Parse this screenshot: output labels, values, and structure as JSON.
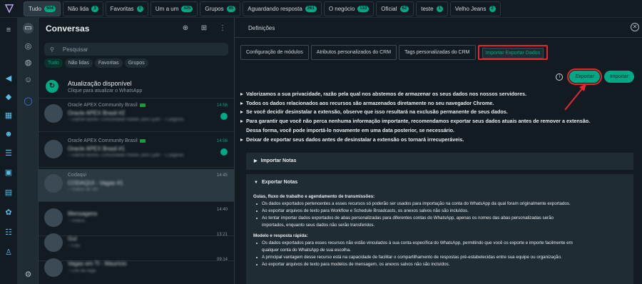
{
  "filter_tabs": [
    {
      "label": "Tudo",
      "count": "504",
      "active": true
    },
    {
      "label": "Não lida",
      "count": "3"
    },
    {
      "label": "Favoritas",
      "count": "0"
    },
    {
      "label": "Um a um",
      "count": "425"
    },
    {
      "label": "Grupos",
      "count": "85"
    },
    {
      "label": "Aguardando resposta",
      "count": "261"
    },
    {
      "label": "O negócio",
      "count": "133"
    },
    {
      "label": "Oficial",
      "count": "62"
    },
    {
      "label": "teste",
      "count": "1"
    },
    {
      "label": "Velho Jeans",
      "count": "2"
    }
  ],
  "chats": {
    "title": "Conversas",
    "search_placeholder": "Pesquisar",
    "pills": [
      "Tudo",
      "Não lidas",
      "Favoritas",
      "Grupos"
    ],
    "update": {
      "title": "Atualização disponível",
      "subtitle": "Clique para atualizar o WhatsApp"
    },
    "rows": [
      {
        "label": "Oracle APEX Community Brasil",
        "name": "Oracle APEX Brasil #2",
        "msg": "~ Gabriel Benko: Comunidade Rafael, pelo Lyall! ~ 2 páginas",
        "time": "14:56",
        "unread": true,
        "flag": true
      },
      {
        "label": "Oracle APEX Community Brasil",
        "name": "Oracle APEX Brasil #1",
        "msg": "~ Gabriel Benko: Comunidade Rafael, pelo Lyall! ~ 2 páginas",
        "time": "14:56",
        "unread": true,
        "flag": true
      },
      {
        "label": "Codaqui",
        "name": "CODAQUI - Vagas #1",
        "msg": "~ Vídeos 4k Ver",
        "time": "14:45",
        "selected": true
      },
      {
        "label": "",
        "name": "Mensagens",
        "msg": "~ Vídeos",
        "time": "14:40"
      },
      {
        "label": "",
        "name": "Guí",
        "msg": "~ Foto",
        "time": "13:21"
      },
      {
        "label": "",
        "name": "Vagas em TI - Maurício",
        "msg": "~ Link da vaga",
        "time": "09:14"
      }
    ]
  },
  "settings": {
    "title": "Definições",
    "tabs": [
      "Configuração de módulos",
      "Atributos personalizados do CRM",
      "Tags personalizadas do CRM",
      "Importar Exportar Dados"
    ],
    "export_label": "Exportar",
    "import_label": "Importar",
    "bullets": [
      "Valorizamos a sua privacidade, razão pela qual nos abstemos de armazenar os seus dados nos nossos servidores.",
      "Todos os dados relacionados aos recursos são armazenados diretamente no seu navegador Chrome.",
      "Se você decidir desinstalar a extensão, observe que isso resultará na exclusão permanente de seus dados.",
      "Para garantir que você não perca nenhuma informação importante, recomendamos exportar seus dados atuais antes de remover a extensão.",
      "Dessa forma, você pode importá-lo novamente em uma data posterior, se necessário.",
      "Deixar de exportar seus dados antes de desinstalar a extensão os tornará irrecuperáveis."
    ],
    "import_notes": "Importar Notas",
    "export_notes": "Exportar Notas",
    "sec1_title": "Guias, fluxo de trabalho e agendamento de transmissões:",
    "sec1_items": [
      "Os dados exportados pertencentes a esses recursos só poderão ser usados para importação na conta do WhatsApp da qual foram originalmente exportados.",
      "Ao exportar arquivos de texto para Workflow e Schedule Broadcasts, os anexos salvos não são incluídos.",
      "Ao tentar importar dados exportados de abas personalizadas para diferentes contas do WhatsApp, apenas os nomes das abas personalizadas serão",
      "importados, enquanto seus dados não serão transferidos."
    ],
    "sec2_title": "Modelo e resposta rápida:",
    "sec2_items": [
      "Os dados exportados para esses recursos não estão vinculados à sua conta específica do WhatsApp, permitindo que você os exporte e importe facilmente em",
      "qualquer conta do WhatsApp de sua escolha.",
      "A principal vantagem desse recurso está na capacidade de facilitar o compartilhamento de respostas pré-estabelecidas entre sua equipe ou organização.",
      "Ao exportar arquivos de texto para modelos de mensagem, os anexos salvos não são incluídos."
    ]
  },
  "colors": {
    "accent": "#00a884",
    "highlight": "#e8262d",
    "background": "#111b21"
  }
}
